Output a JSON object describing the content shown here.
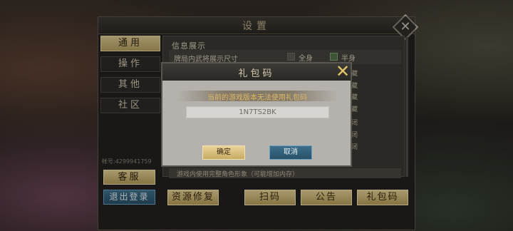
{
  "settings": {
    "title": "设置",
    "tabs": [
      "通用",
      "操作",
      "其他",
      "社区"
    ],
    "account_id": "帐号:4299941759",
    "customer_service_label": "客服",
    "logout_label": "退出登录",
    "section_title": "信息展示",
    "row_label": "牌局内武将展示尺寸",
    "option_full": "全身",
    "option_half": "半身",
    "right_chars": [
      "藏",
      "藏",
      "藏",
      "藏",
      "闭",
      "闭",
      "闭"
    ],
    "bottom_text": "游戏内使用完整角色形象（可能增加内存）",
    "footer_buttons": [
      "资源修复",
      "扫码",
      "公告",
      "礼包码"
    ]
  },
  "dialog": {
    "title": "礼包码",
    "message": "当前的游戏版本无法使用礼包码",
    "code_value": "1N7TS2BK",
    "confirm_label": "确定",
    "cancel_label": "取消"
  }
}
